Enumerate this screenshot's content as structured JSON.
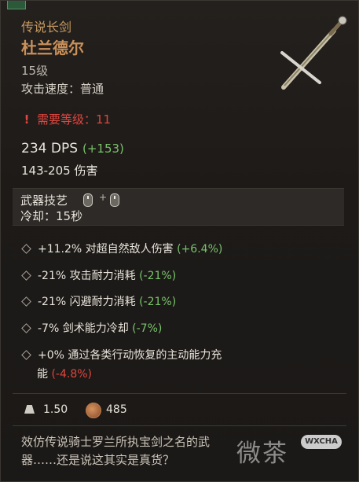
{
  "item": {
    "type_label": "传说长剑",
    "name": "杜兰德尔",
    "level": "15级",
    "attack_speed": "攻击速度：普通",
    "requirement": "需要等级：11",
    "requirement_mark": "!",
    "dps": "234 DPS",
    "dps_bonus": "(+153)",
    "damage": "143-205 伤害"
  },
  "skill": {
    "title": "武器技艺",
    "plus": "+",
    "cooldown": "冷却：15秒",
    "icons": [
      "left-mouse-icon",
      "right-mouse-icon"
    ]
  },
  "affixes": [
    {
      "text": "+11.2% 对超自然敌人伤害",
      "delta": "(+6.4%)",
      "sign": "positive"
    },
    {
      "text": "-21% 攻击耐力消耗",
      "delta": "(-21%)",
      "sign": "positive"
    },
    {
      "text": "-21% 闪避耐力消耗",
      "delta": "(-21%)",
      "sign": "positive"
    },
    {
      "text": "-7% 剑术能力冷却",
      "delta": "(-7%)",
      "sign": "positive"
    },
    {
      "text": "+0% 通过各类行动恢复的主动能力充",
      "continuation": "能",
      "delta": "(-4.8%)",
      "sign": "negative"
    }
  ],
  "footer": {
    "weight": "1.50",
    "value": "485",
    "weight_icon": "weight-icon",
    "value_icon": "gold-coin-icon"
  },
  "flavor": {
    "line1": "效仿传说骑士罗兰所执宝剑之名的武",
    "line2": "器……还是说这其实是真货？"
  },
  "watermark": {
    "text": "微茶",
    "badge": "WXCHA"
  },
  "colors": {
    "rarity": "#c9905a",
    "positive": "#79c36a",
    "negative": "#e0463e",
    "text": "#e9e4db"
  }
}
